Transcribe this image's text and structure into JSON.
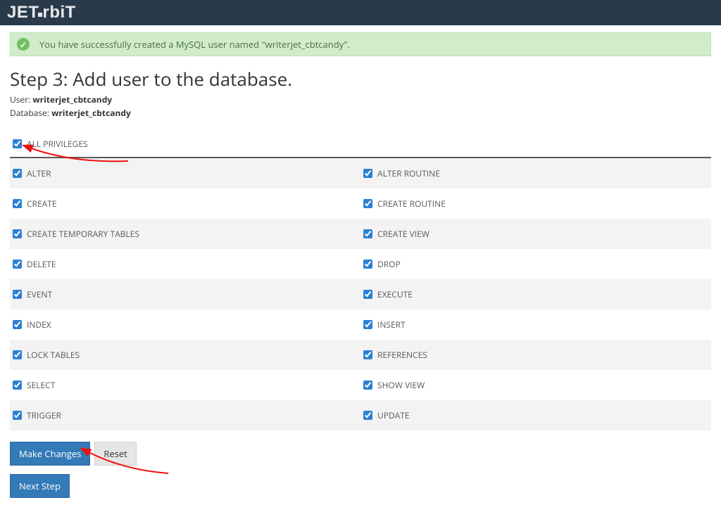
{
  "logo": "JETorbiT",
  "alert": {
    "message": "You have successfully created a MySQL user named \"writerjet_cbtcandy\"."
  },
  "step_title": "Step 3: Add user to the database.",
  "user_label": "User:",
  "user_value": "writerjet_cbtcandy",
  "database_label": "Database:",
  "database_value": "writerjet_cbtcandy",
  "all_privileges_label": "ALL PRIVILEGES",
  "privileges": [
    {
      "left": "ALTER",
      "right": "ALTER ROUTINE"
    },
    {
      "left": "CREATE",
      "right": "CREATE ROUTINE"
    },
    {
      "left": "CREATE TEMPORARY TABLES",
      "right": "CREATE VIEW"
    },
    {
      "left": "DELETE",
      "right": "DROP"
    },
    {
      "left": "EVENT",
      "right": "EXECUTE"
    },
    {
      "left": "INDEX",
      "right": "INSERT"
    },
    {
      "left": "LOCK TABLES",
      "right": "REFERENCES"
    },
    {
      "left": "SELECT",
      "right": "SHOW VIEW"
    },
    {
      "left": "TRIGGER",
      "right": "UPDATE"
    }
  ],
  "buttons": {
    "make_changes": "Make Changes",
    "reset": "Reset",
    "next_step": "Next Step"
  }
}
